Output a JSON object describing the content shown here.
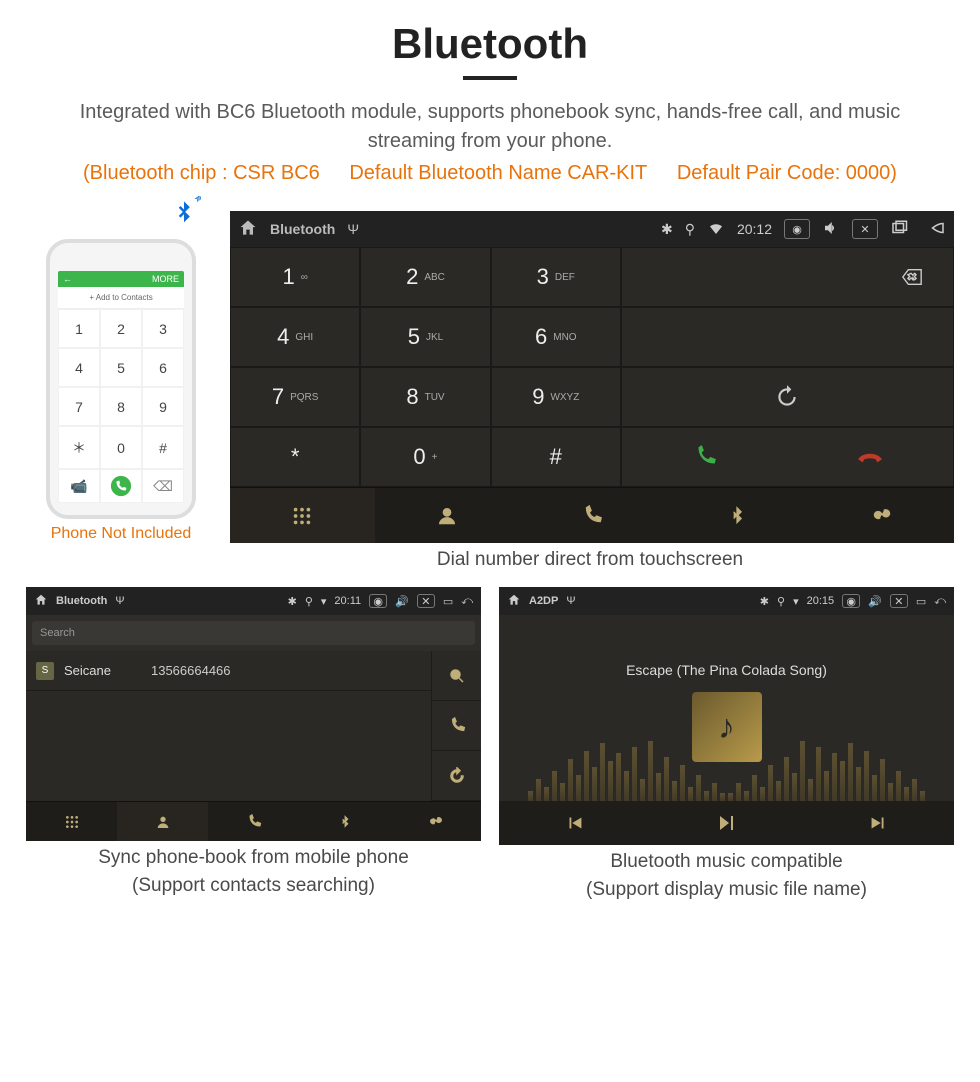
{
  "header": {
    "title": "Bluetooth",
    "desc": "Integrated with BC6 Bluetooth module, supports phonebook sync, hands-free call, and music streaming from your phone."
  },
  "specs": {
    "chip": "(Bluetooth chip : CSR BC6",
    "name": "Default Bluetooth Name CAR-KIT",
    "code": "Default Pair Code: 0000)"
  },
  "phone": {
    "add": "+  Add to Contacts",
    "more": "MORE",
    "caption": "Phone Not Included"
  },
  "main": {
    "title": "Bluetooth",
    "time": "20:12",
    "keys": [
      {
        "n": "1",
        "l": "∞"
      },
      {
        "n": "2",
        "l": "ABC"
      },
      {
        "n": "3",
        "l": "DEF"
      },
      {
        "n": "4",
        "l": "GHI"
      },
      {
        "n": "5",
        "l": "JKL"
      },
      {
        "n": "6",
        "l": "MNO"
      },
      {
        "n": "7",
        "l": "PQRS"
      },
      {
        "n": "8",
        "l": "TUV"
      },
      {
        "n": "9",
        "l": "WXYZ"
      },
      {
        "n": "*",
        "l": ""
      },
      {
        "n": "0",
        "l": "+"
      },
      {
        "n": "#",
        "l": ""
      }
    ],
    "caption": "Dial number direct from touchscreen"
  },
  "pb": {
    "title": "Bluetooth",
    "time": "20:11",
    "search": "Search",
    "contact": {
      "initial": "S",
      "name": "Seicane",
      "number": "13566664466"
    },
    "caption1": "Sync phone-book from mobile phone",
    "caption2": "(Support contacts searching)"
  },
  "a2dp": {
    "title": "A2DP",
    "time": "20:15",
    "song": "Escape (The Pina Colada Song)",
    "caption1": "Bluetooth music compatible",
    "caption2": "(Support display music file name)"
  }
}
